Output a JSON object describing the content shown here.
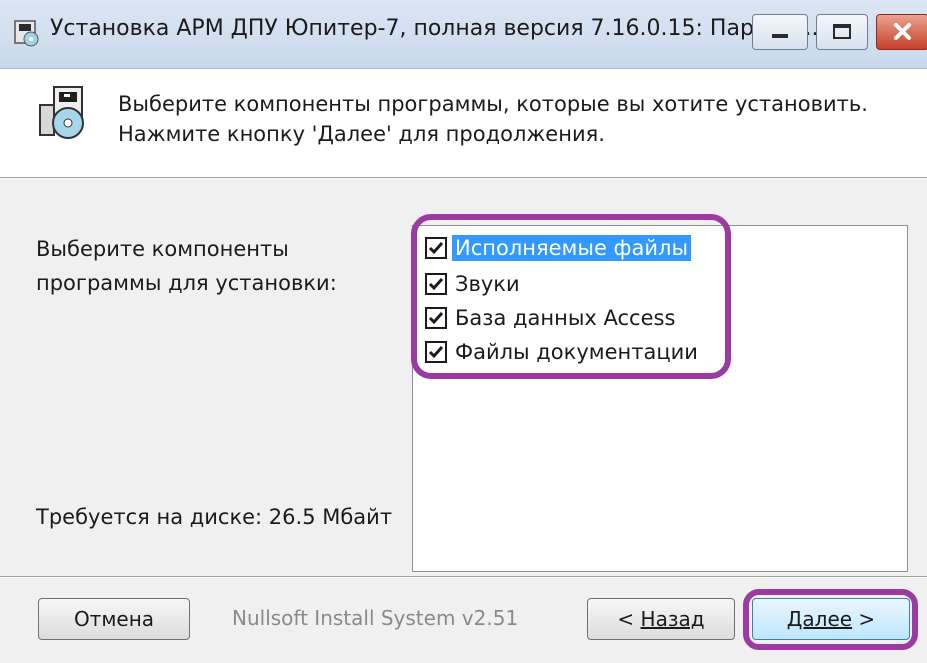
{
  "window": {
    "title": "Установка АРМ ДПУ Юпитер-7, полная версия 7.16.0.15: Параме...",
    "title_icon": "installer-icon"
  },
  "header": {
    "line1": "Выберите компоненты программы, которые вы хотите установить.",
    "line2": "Нажмите кнопку 'Далее' для продолжения.",
    "icon": "installer-cd-icon"
  },
  "components": {
    "label_line1": "Выберите компоненты",
    "label_line2": "программы для установки:",
    "items": [
      {
        "label": "Исполняемые файлы",
        "checked": true,
        "selected": true
      },
      {
        "label": "Звуки",
        "checked": true,
        "selected": false
      },
      {
        "label": "База данных Access",
        "checked": true,
        "selected": false
      },
      {
        "label": "Файлы документации",
        "checked": true,
        "selected": false
      }
    ],
    "disk_required": "Требуется на диске: 26.5 Мбайт"
  },
  "footer": {
    "branding": "Nullsoft Install System v2.51",
    "cancel_label": "Отмена",
    "back_prefix": "< ",
    "back_label": "Назад",
    "next_label": "Далее",
    "next_suffix": " >"
  },
  "annotation": {
    "color": "#9b3ba2"
  }
}
